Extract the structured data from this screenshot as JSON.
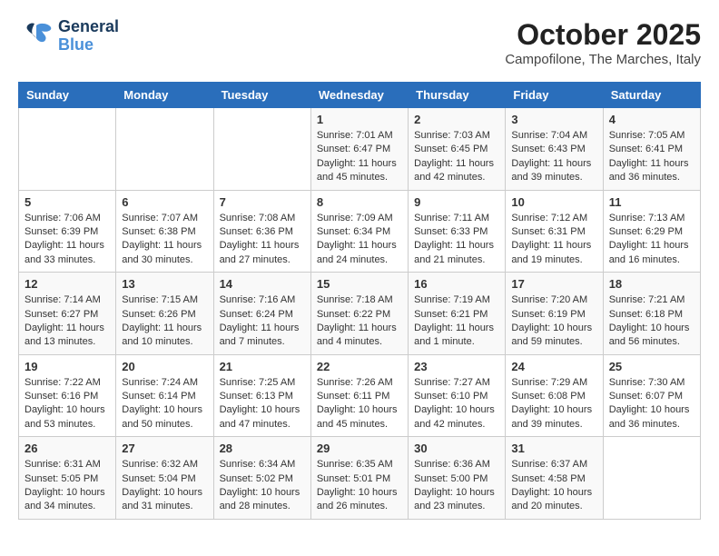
{
  "header": {
    "logo_general": "General",
    "logo_blue": "Blue",
    "month": "October 2025",
    "location": "Campofilone, The Marches, Italy"
  },
  "weekdays": [
    "Sunday",
    "Monday",
    "Tuesday",
    "Wednesday",
    "Thursday",
    "Friday",
    "Saturday"
  ],
  "weeks": [
    [
      {
        "day": "",
        "info": ""
      },
      {
        "day": "",
        "info": ""
      },
      {
        "day": "",
        "info": ""
      },
      {
        "day": "1",
        "info": "Sunrise: 7:01 AM\nSunset: 6:47 PM\nDaylight: 11 hours and 45 minutes."
      },
      {
        "day": "2",
        "info": "Sunrise: 7:03 AM\nSunset: 6:45 PM\nDaylight: 11 hours and 42 minutes."
      },
      {
        "day": "3",
        "info": "Sunrise: 7:04 AM\nSunset: 6:43 PM\nDaylight: 11 hours and 39 minutes."
      },
      {
        "day": "4",
        "info": "Sunrise: 7:05 AM\nSunset: 6:41 PM\nDaylight: 11 hours and 36 minutes."
      }
    ],
    [
      {
        "day": "5",
        "info": "Sunrise: 7:06 AM\nSunset: 6:39 PM\nDaylight: 11 hours and 33 minutes."
      },
      {
        "day": "6",
        "info": "Sunrise: 7:07 AM\nSunset: 6:38 PM\nDaylight: 11 hours and 30 minutes."
      },
      {
        "day": "7",
        "info": "Sunrise: 7:08 AM\nSunset: 6:36 PM\nDaylight: 11 hours and 27 minutes."
      },
      {
        "day": "8",
        "info": "Sunrise: 7:09 AM\nSunset: 6:34 PM\nDaylight: 11 hours and 24 minutes."
      },
      {
        "day": "9",
        "info": "Sunrise: 7:11 AM\nSunset: 6:33 PM\nDaylight: 11 hours and 21 minutes."
      },
      {
        "day": "10",
        "info": "Sunrise: 7:12 AM\nSunset: 6:31 PM\nDaylight: 11 hours and 19 minutes."
      },
      {
        "day": "11",
        "info": "Sunrise: 7:13 AM\nSunset: 6:29 PM\nDaylight: 11 hours and 16 minutes."
      }
    ],
    [
      {
        "day": "12",
        "info": "Sunrise: 7:14 AM\nSunset: 6:27 PM\nDaylight: 11 hours and 13 minutes."
      },
      {
        "day": "13",
        "info": "Sunrise: 7:15 AM\nSunset: 6:26 PM\nDaylight: 11 hours and 10 minutes."
      },
      {
        "day": "14",
        "info": "Sunrise: 7:16 AM\nSunset: 6:24 PM\nDaylight: 11 hours and 7 minutes."
      },
      {
        "day": "15",
        "info": "Sunrise: 7:18 AM\nSunset: 6:22 PM\nDaylight: 11 hours and 4 minutes."
      },
      {
        "day": "16",
        "info": "Sunrise: 7:19 AM\nSunset: 6:21 PM\nDaylight: 11 hours and 1 minute."
      },
      {
        "day": "17",
        "info": "Sunrise: 7:20 AM\nSunset: 6:19 PM\nDaylight: 10 hours and 59 minutes."
      },
      {
        "day": "18",
        "info": "Sunrise: 7:21 AM\nSunset: 6:18 PM\nDaylight: 10 hours and 56 minutes."
      }
    ],
    [
      {
        "day": "19",
        "info": "Sunrise: 7:22 AM\nSunset: 6:16 PM\nDaylight: 10 hours and 53 minutes."
      },
      {
        "day": "20",
        "info": "Sunrise: 7:24 AM\nSunset: 6:14 PM\nDaylight: 10 hours and 50 minutes."
      },
      {
        "day": "21",
        "info": "Sunrise: 7:25 AM\nSunset: 6:13 PM\nDaylight: 10 hours and 47 minutes."
      },
      {
        "day": "22",
        "info": "Sunrise: 7:26 AM\nSunset: 6:11 PM\nDaylight: 10 hours and 45 minutes."
      },
      {
        "day": "23",
        "info": "Sunrise: 7:27 AM\nSunset: 6:10 PM\nDaylight: 10 hours and 42 minutes."
      },
      {
        "day": "24",
        "info": "Sunrise: 7:29 AM\nSunset: 6:08 PM\nDaylight: 10 hours and 39 minutes."
      },
      {
        "day": "25",
        "info": "Sunrise: 7:30 AM\nSunset: 6:07 PM\nDaylight: 10 hours and 36 minutes."
      }
    ],
    [
      {
        "day": "26",
        "info": "Sunrise: 6:31 AM\nSunset: 5:05 PM\nDaylight: 10 hours and 34 minutes."
      },
      {
        "day": "27",
        "info": "Sunrise: 6:32 AM\nSunset: 5:04 PM\nDaylight: 10 hours and 31 minutes."
      },
      {
        "day": "28",
        "info": "Sunrise: 6:34 AM\nSunset: 5:02 PM\nDaylight: 10 hours and 28 minutes."
      },
      {
        "day": "29",
        "info": "Sunrise: 6:35 AM\nSunset: 5:01 PM\nDaylight: 10 hours and 26 minutes."
      },
      {
        "day": "30",
        "info": "Sunrise: 6:36 AM\nSunset: 5:00 PM\nDaylight: 10 hours and 23 minutes."
      },
      {
        "day": "31",
        "info": "Sunrise: 6:37 AM\nSunset: 4:58 PM\nDaylight: 10 hours and 20 minutes."
      },
      {
        "day": "",
        "info": ""
      }
    ]
  ]
}
